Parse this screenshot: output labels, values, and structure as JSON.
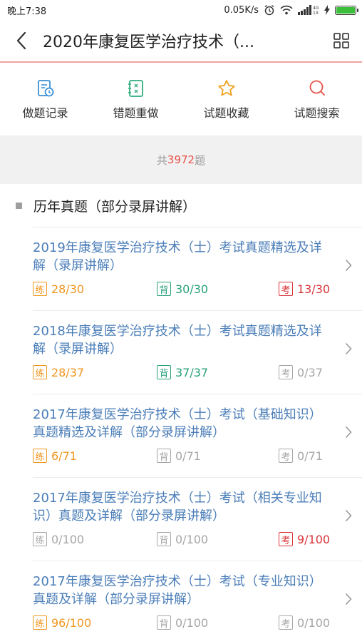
{
  "status": {
    "time": "晚上7:38",
    "speed": "0.05K/s"
  },
  "header": {
    "title": "2020年康复医学治疗技术（..."
  },
  "actions": [
    {
      "label": "做题记录",
      "icon": "record-icon"
    },
    {
      "label": "错题重做",
      "icon": "wrong-redo-icon"
    },
    {
      "label": "试题收藏",
      "icon": "star-icon"
    },
    {
      "label": "试题搜索",
      "icon": "search-icon"
    }
  ],
  "count": {
    "prefix": "共",
    "value": "3972",
    "suffix": "题"
  },
  "section": {
    "title": "历年真题（部分录屏讲解）"
  },
  "tags": {
    "practice": "练",
    "recite": "背",
    "exam": "考"
  },
  "items": [
    {
      "title": "2019年康复医学治疗技术（士）考试真题精选及详解（录屏讲解）",
      "practice": "28/30",
      "recite": "30/30",
      "exam": "13/30",
      "p_active": true,
      "r_active": true,
      "e_active": true
    },
    {
      "title": "2018年康复医学治疗技术（士）考试真题精选及详解（录屏讲解）",
      "practice": "28/37",
      "recite": "37/37",
      "exam": "0/37",
      "p_active": true,
      "r_active": true,
      "e_active": false
    },
    {
      "title": "2017年康复医学治疗技术（士）考试（基础知识）真题精选及详解（部分录屏讲解）",
      "practice": "6/71",
      "recite": "0/71",
      "exam": "0/71",
      "p_active": true,
      "r_active": false,
      "e_active": false
    },
    {
      "title": "2017年康复医学治疗技术（士）考试（相关专业知识）真题及详解（部分录屏讲解）",
      "practice": "0/100",
      "recite": "0/100",
      "exam": "9/100",
      "p_active": false,
      "r_active": false,
      "e_active": true
    },
    {
      "title": "2017年康复医学治疗技术（士）考试（专业知识）真题及详解（部分录屏讲解）",
      "practice": "96/100",
      "recite": "0/100",
      "exam": "0/100",
      "p_active": true,
      "r_active": false,
      "e_active": false
    }
  ],
  "colors": {
    "practice": "#f0961e",
    "recite": "#27a07a",
    "exam": "#d9343a",
    "inactive": "#a6a6a6",
    "title": "#4a7db8",
    "accent": "#e8524a"
  }
}
